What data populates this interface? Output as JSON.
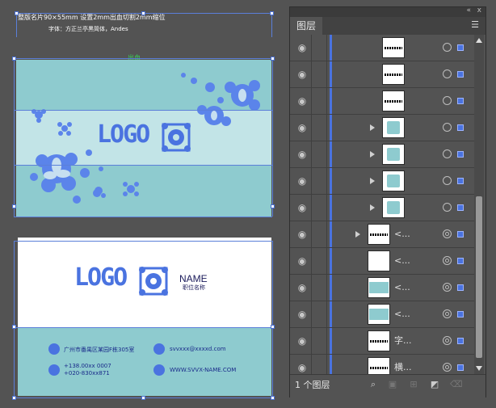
{
  "canvas": {
    "note_line1": "整版名片90×55mm   设置2mm出血切割2mm缩位",
    "note_line2": "字体：方正兰亭黑简体，Andes",
    "guide_label": "出血",
    "front": {
      "logo": "LOGO"
    },
    "back": {
      "logo": "LOGO",
      "name": "NAME",
      "title": "职位名称",
      "address": "广州市番禺区某园F栋305室",
      "email": "svvxxx@xxxxd.com",
      "phone1": "+138.00xx 0007",
      "phone2": "+020-830xx871",
      "website": "WWW.SVVX-NAME.COM"
    }
  },
  "panel": {
    "collapse_icon": "«",
    "close_icon": "x",
    "tab": "图层",
    "menu_icon": "☰",
    "layers": [
      {
        "name": "",
        "expandable": false,
        "thumb": "strip"
      },
      {
        "name": "",
        "expandable": false,
        "thumb": "strip"
      },
      {
        "name": "",
        "expandable": false,
        "thumb": "strip"
      },
      {
        "name": "",
        "expandable": true,
        "thumb": "home-icon"
      },
      {
        "name": "",
        "expandable": true,
        "thumb": "phone-icon"
      },
      {
        "name": "",
        "expandable": true,
        "thumb": "mail-icon"
      },
      {
        "name": "",
        "expandable": true,
        "thumb": "globe-icon"
      },
      {
        "name": "<...",
        "expandable": true,
        "thumb": "strip"
      },
      {
        "name": "<...",
        "expandable": false,
        "thumb": "blank"
      },
      {
        "name": "<...",
        "expandable": false,
        "thumb": "teal"
      },
      {
        "name": "<...",
        "expandable": false,
        "thumb": "teal"
      },
      {
        "name": "字...",
        "expandable": false,
        "thumb": "strip"
      },
      {
        "name": "横...",
        "expandable": false,
        "thumb": "strip"
      }
    ],
    "footer_text": "1 个图层"
  },
  "colors": {
    "accent": "#4a73e0",
    "teal": "#8ecbcf",
    "panel": "#535353"
  }
}
